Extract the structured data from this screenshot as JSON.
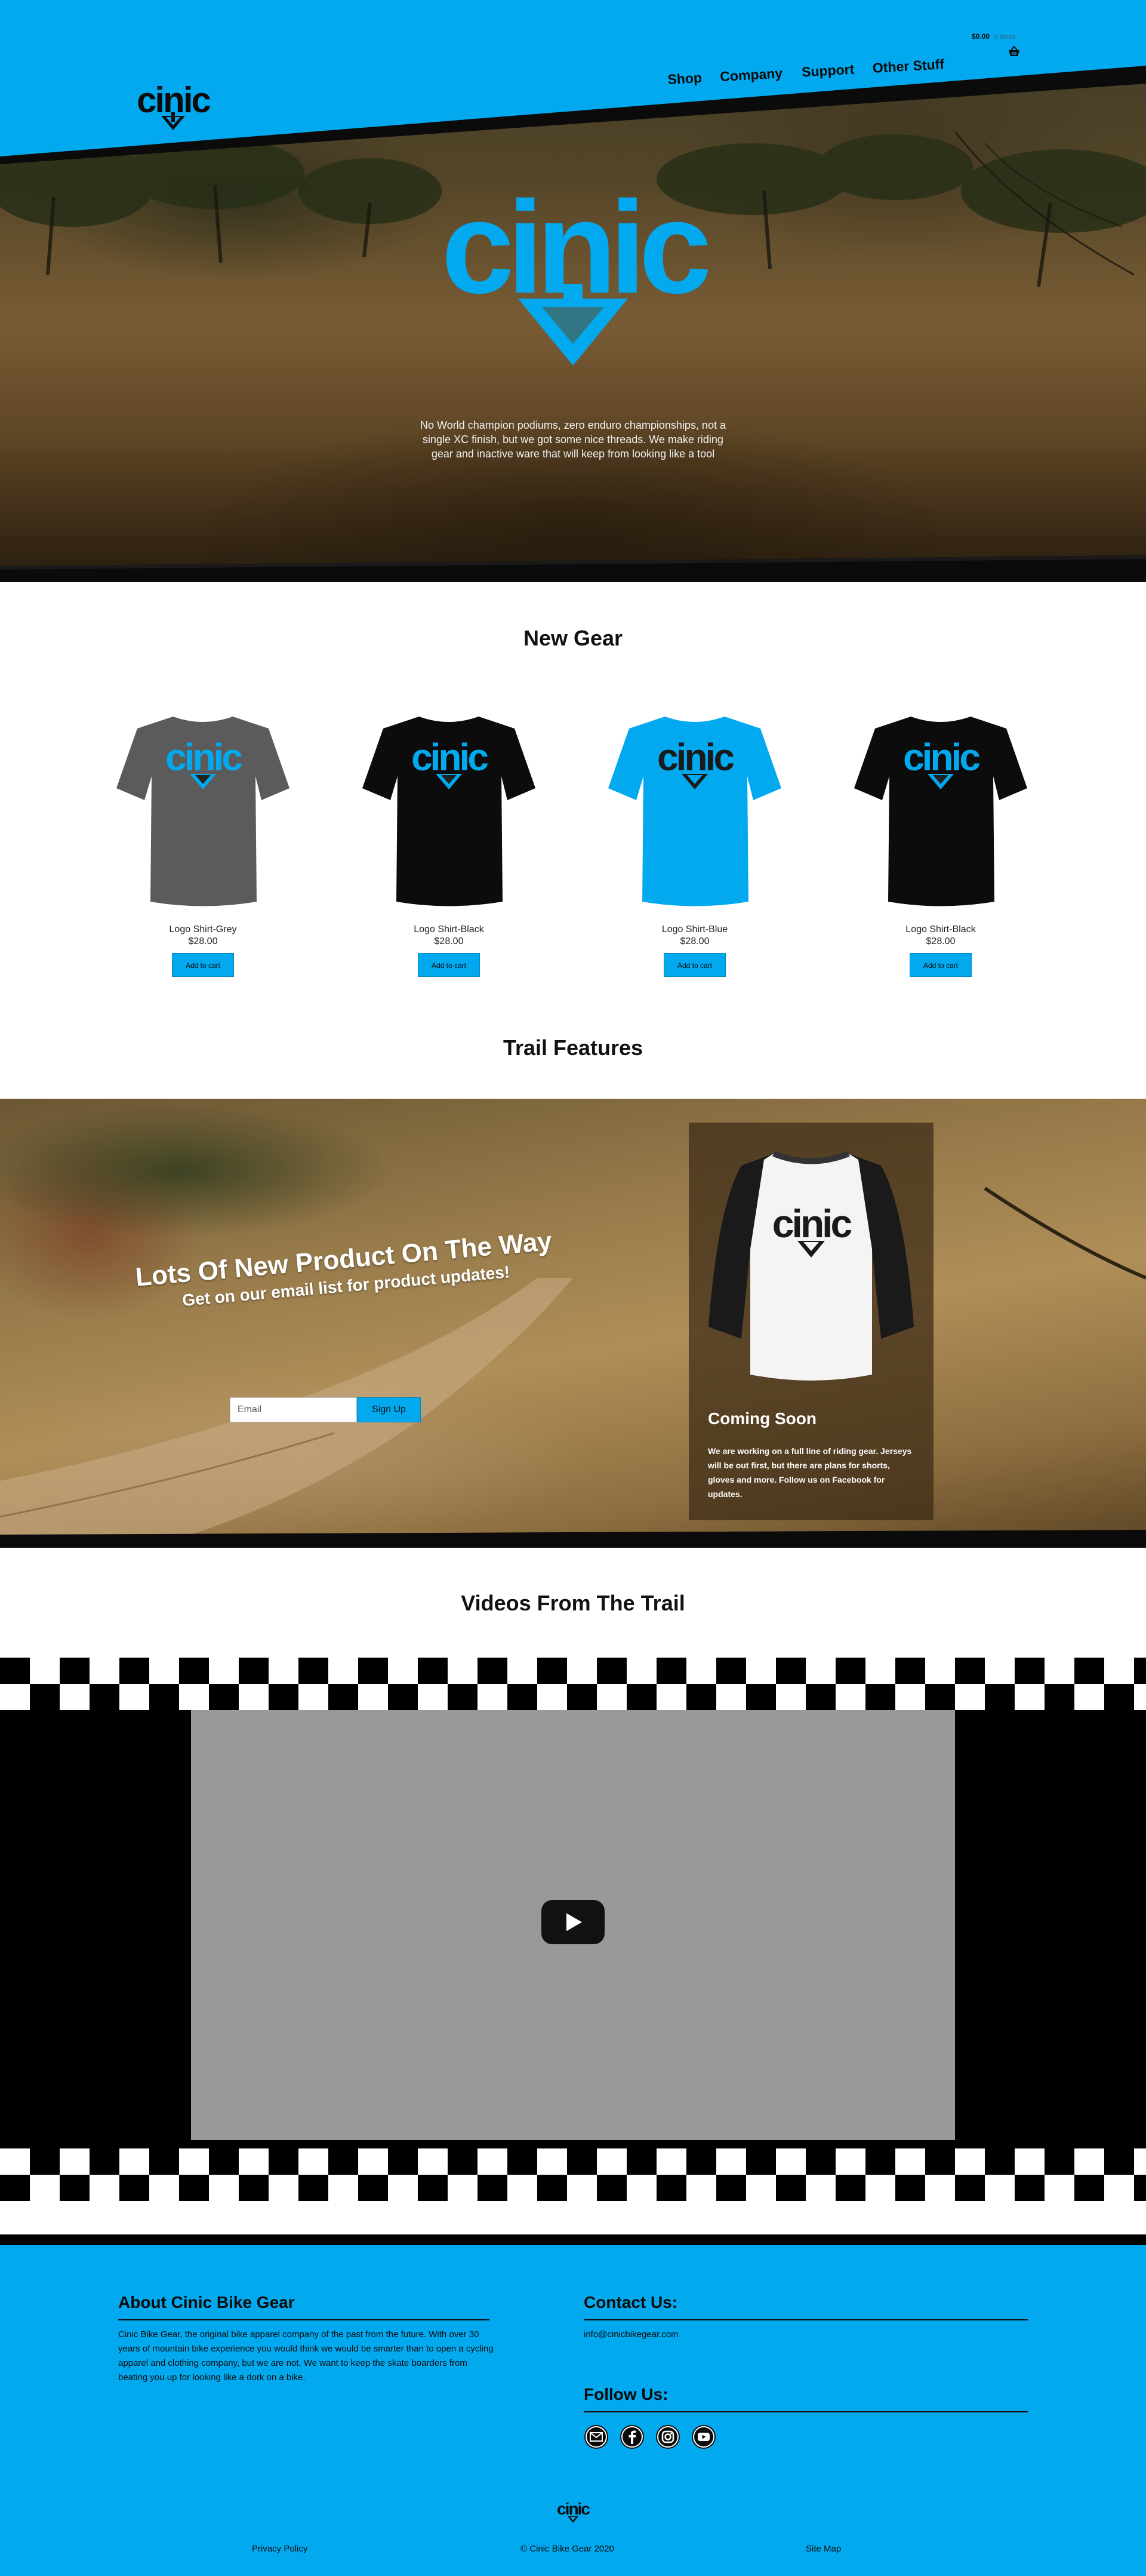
{
  "brand": {
    "logo_text": "cinic",
    "accent_color": "#03a9ef",
    "dark_color": "#0b0b0b"
  },
  "nav": {
    "items": [
      "Shop",
      "Company",
      "Support",
      "Other Stuff"
    ]
  },
  "cart": {
    "amount": "$0.00",
    "count": "0 items",
    "icon": "basket-icon"
  },
  "hero": {
    "tagline": "No World champion podiums, zero enduro championships, not a single XC finish, but we got some nice threads. We make riding gear and inactive ware that will keep from looking like a tool"
  },
  "new_gear": {
    "title": "New Gear",
    "products": [
      {
        "name": "Logo Shirt-Grey",
        "price": "$28.00",
        "button": "Add to cart",
        "color": "#5b5b5b"
      },
      {
        "name": "Logo Shirt-Black",
        "price": "$28.00",
        "button": "Add to cart",
        "color": "#0c0c0c"
      },
      {
        "name": "Logo Shirt-Blue",
        "price": "$28.00",
        "button": "Add to cart",
        "color": "#03a9ef"
      },
      {
        "name": "Logo Shirt-Black",
        "price": "$28.00",
        "button": "Add to cart",
        "color": "#0c0c0c"
      }
    ]
  },
  "trail_features": {
    "title": "Trail Features",
    "promo_title": "Lots Of New Product On The Way",
    "promo_subtitle": "Get on our email list for product updates!",
    "email_placeholder": "Email",
    "signup_label": "Sign Up",
    "coming_soon_title": "Coming Soon",
    "coming_soon_text": "We are working on a full line of riding gear. Jerseys will be out first, but there are plans for shorts, gloves and more. Follow us on Facebook for updates."
  },
  "videos": {
    "title": "Videos From The Trail",
    "play_icon": "youtube-play-icon"
  },
  "footer": {
    "about_title": "About Cinic Bike Gear",
    "about_text": "Cinic Bike Gear, the original bike apparel company of the past from the future. With over 30 years of mountain bike experience you would think we would be smarter than to open a cycling apparel and clothing company, but we are not. We want to keep the skate boarders from beating you up for looking like a dork on a bike.",
    "contact_title": "Contact Us:",
    "contact_email": "info@cinicbikegear.com",
    "follow_title": "Follow Us:",
    "social_icons": [
      "email-icon",
      "facebook-icon",
      "instagram-icon",
      "youtube-icon"
    ],
    "links": [
      "Privacy Policy",
      "© Cinic Bike Gear 2020",
      "Site Map"
    ]
  }
}
